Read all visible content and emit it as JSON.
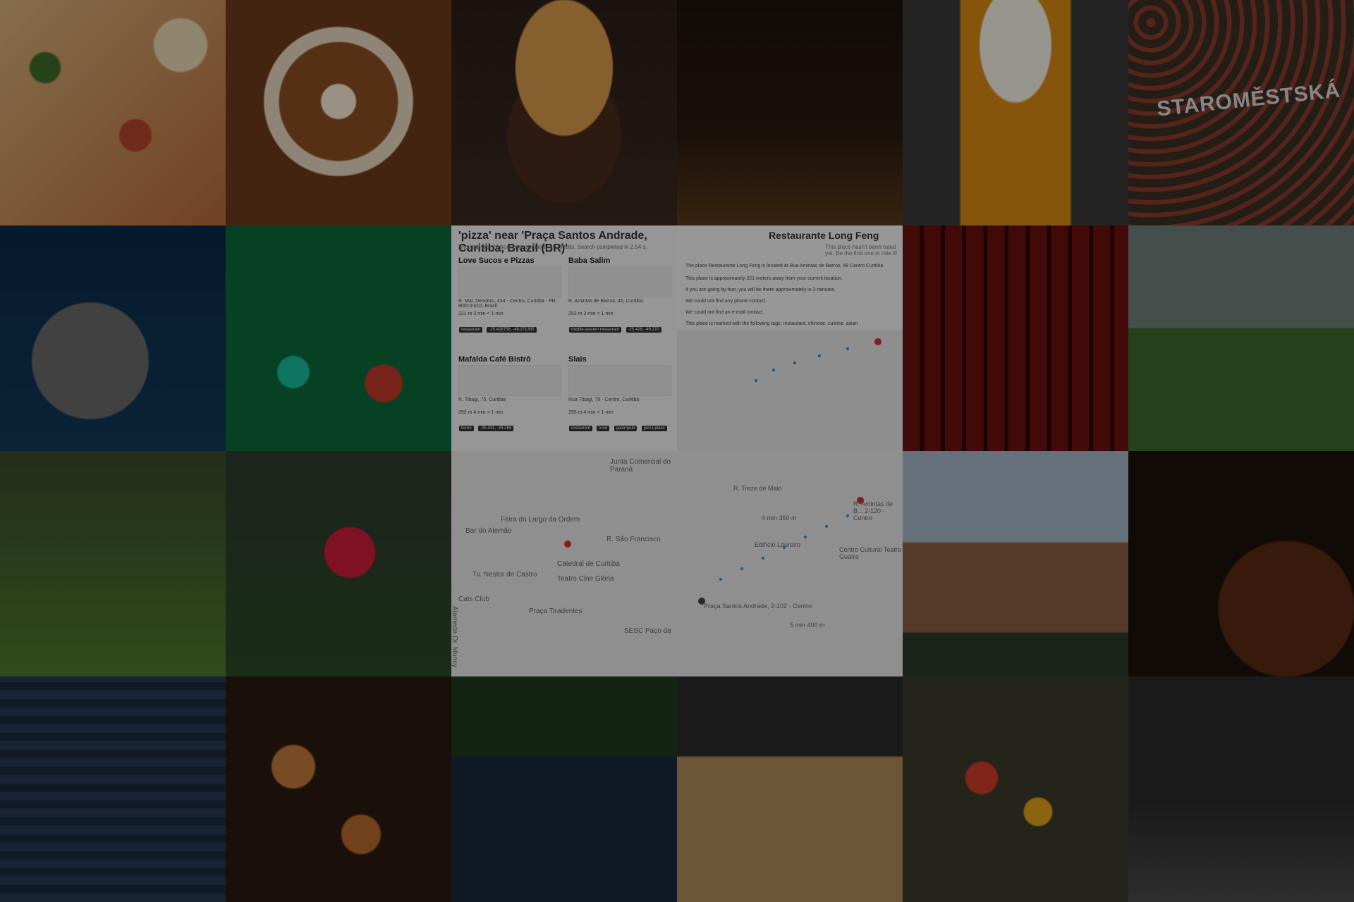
{
  "grid": {
    "tiles": [
      {
        "name": "tile-pizza",
        "class": "pizza"
      },
      {
        "name": "tile-coffee",
        "class": "coffee"
      },
      {
        "name": "tile-burger",
        "class": "burger"
      },
      {
        "name": "tile-bar",
        "class": "bar"
      },
      {
        "name": "tile-beer",
        "class": "beer"
      },
      {
        "name": "tile-metro",
        "class": "metro",
        "caption": "STAROMĚSTSKÁ"
      },
      {
        "name": "tile-aquarium",
        "class": "aquarium"
      },
      {
        "name": "tile-casino",
        "class": "casino"
      },
      {
        "name": "tile-search",
        "class": "search"
      },
      {
        "name": "tile-detail",
        "class": "detail"
      },
      {
        "name": "tile-cinema",
        "class": "cinema"
      },
      {
        "name": "tile-park",
        "class": "park"
      },
      {
        "name": "tile-yoga",
        "class": "yoga"
      },
      {
        "name": "tile-golf",
        "class": "golf"
      },
      {
        "name": "tile-map-left",
        "class": "map1"
      },
      {
        "name": "tile-map-right",
        "class": "map2"
      },
      {
        "name": "tile-castle",
        "class": "castle"
      },
      {
        "name": "tile-cellar",
        "class": "cellar"
      },
      {
        "name": "tile-building",
        "class": "building"
      },
      {
        "name": "tile-bakery",
        "class": "bakery"
      },
      {
        "name": "tile-stadium",
        "class": "stadium"
      },
      {
        "name": "tile-bowling",
        "class": "bowling"
      },
      {
        "name": "tile-market",
        "class": "market"
      },
      {
        "name": "tile-airport",
        "class": "airport"
      }
    ]
  },
  "search": {
    "title": "'pizza' near 'Praça Santos Andrade, Curitiba, Brazil (BR)'",
    "meta": "Showing first 21 from approximately 49 results. Search completed in 2.54 s.",
    "cards": [
      {
        "name": "Love Sucos e Pizzas",
        "addr": "R. Mal. Deodoro, 434 - Centro, Curitiba - PR, 80010-010, Brazil",
        "metric": "221 m   3 min   < 1 min",
        "tags": [
          "restaurant",
          "-25.428758, -49.271355"
        ]
      },
      {
        "name": "Baba Salim",
        "addr": "R. Amintas de Barros, 45, Curitiba",
        "metric": "253 m   3 min   < 1 min",
        "tags": [
          "middle eastern restaurant",
          "-25.428, -49.270"
        ]
      },
      {
        "name": "Mafalda Café Bistrô",
        "addr": "R. Tibagi, 75, Curitiba",
        "metric": "292 m   4 min   < 1 min",
        "tags": [
          "bistro",
          "-25.431, -49.268"
        ]
      },
      {
        "name": "Slais",
        "addr": "Rua Tibagi, 79 - Centro, Curitiba",
        "metric": "295 m   4 min   < 1 min",
        "tags": [
          "restaurant",
          "food",
          "gastropub",
          "pizza place"
        ]
      }
    ]
  },
  "detail": {
    "title": "Restaurante Long Feng",
    "rating": "This place hasn't been rated yet. Be the first one to rate it!",
    "lines": [
      "The place Restaurante Long Feng is located at Rua Amintas de Barros, 68 Centro Curitiba",
      "This place is approximately 221 meters away from your current location.",
      "If you are going by foot, you will be there approximately in 3 minutes.",
      "We could not find any phone contact.",
      "We could not find an e-mail contact.",
      "This place is marked with the following tags: restaurant, chinese, cuisine, asian"
    ]
  },
  "mapLeft": {
    "labels": [
      "Junta Comercial do Paraná",
      "Feira do Largo da Ordem",
      "Bar do Alemão",
      "Catedral de Curitiba",
      "Teatro Cine Glória",
      "Praça Tiradentes",
      "R. São Francisco",
      "Tv. Nestor de Castro",
      "Alameda Dr. Muricy",
      "Cats Club",
      "SESC Paço da"
    ]
  },
  "mapRight": {
    "labels": [
      "R. Amintas de B... 2-120 - Centro",
      "Praça Santos Andrade, 2-102 - Centro",
      "Centro Cultural Teatro Guaíra",
      "R. Treze de Maio",
      "Edifício Loureiro",
      "5 min 400 m",
      "4 min 350 m"
    ]
  }
}
